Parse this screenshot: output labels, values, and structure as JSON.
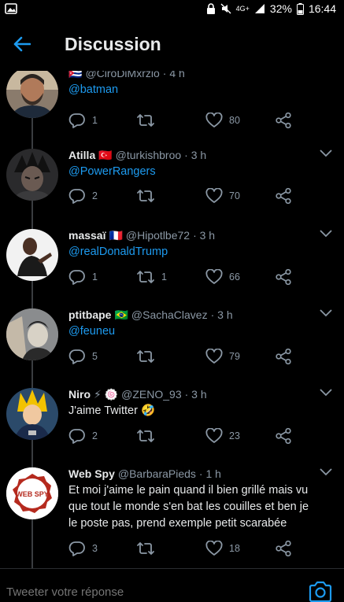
{
  "status_bar": {
    "network": "4G+",
    "battery": "32%",
    "time": "16:44"
  },
  "header": {
    "title": "Discussion"
  },
  "tweets": [
    {
      "name": "",
      "flag": "🇨🇺",
      "handle": "@CiroDiMxrzio",
      "time": "· 4 h",
      "text": "",
      "mention": "@batman",
      "replies": "1",
      "retweets": "",
      "likes": "80",
      "avatar_icon": "man-beard-avatar"
    },
    {
      "name": "Atilla",
      "flag": "🇹🇷",
      "handle": "@turkishbroo",
      "time": "· 3 h",
      "text": "",
      "mention": "@PowerRangers",
      "replies": "2",
      "retweets": "",
      "likes": "70",
      "avatar_icon": "anime-avatar"
    },
    {
      "name": "massaï",
      "flag": "🇫🇷",
      "handle": "@Hipotlbe72",
      "time": "· 3 h",
      "text": "",
      "mention": "@realDonaldTrump",
      "replies": "1",
      "retweets": "1",
      "likes": "66",
      "avatar_icon": "person-avatar"
    },
    {
      "name": "ptitbape",
      "flag": "🇧🇷",
      "handle": "@SachaClavez",
      "time": "· 3 h",
      "text": "",
      "mention": "@feuneu",
      "replies": "5",
      "retweets": "",
      "likes": "79",
      "avatar_icon": "manga-avatar"
    },
    {
      "name": "Niro",
      "flag": "⚡ 🍥",
      "handle": "@ZENO_93",
      "time": "· 3 h",
      "text": "J'aime Twitter 🤣",
      "mention": "",
      "replies": "2",
      "retweets": "",
      "likes": "23",
      "avatar_icon": "goku-avatar"
    },
    {
      "name": "Web Spy",
      "flag": "",
      "handle": "@BarbaraPieds",
      "time": "· 1 h",
      "text": "Et moi j'aime le pain quand il bien grillé mais vu que tout le monde s'en bat les couilles et ben je le poste pas, prend exemple petit scarabée",
      "mention": "",
      "replies": "3",
      "retweets": "",
      "likes": "18",
      "avatar_icon": "web-spy-logo",
      "avatar_text": "WEB SPY"
    }
  ],
  "reply": {
    "placeholder": "Tweeter votre réponse"
  },
  "colors": {
    "accent": "#1d9bf0",
    "background": "#000000",
    "muted": "#8b98a5"
  }
}
